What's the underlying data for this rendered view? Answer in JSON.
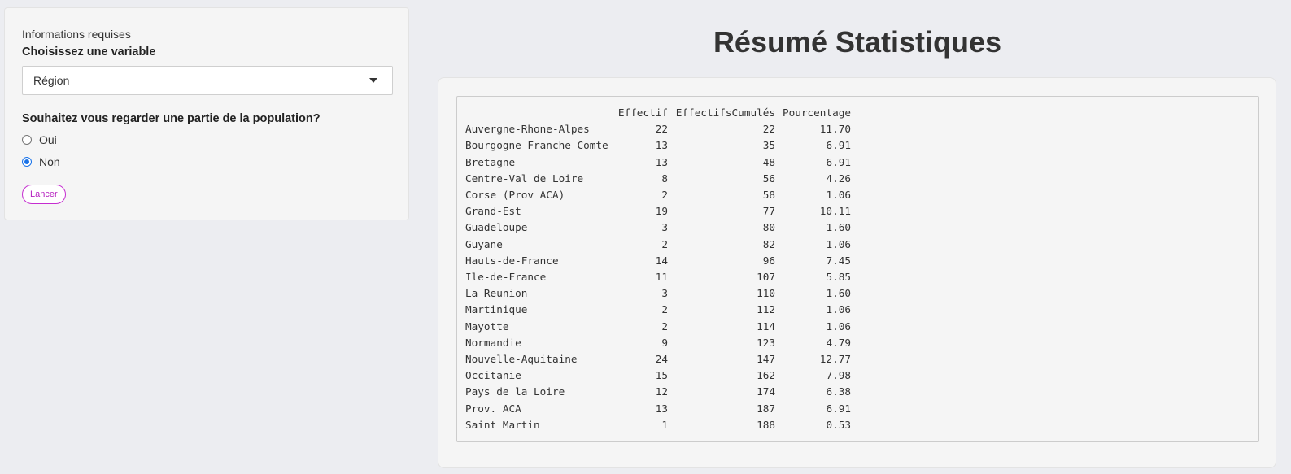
{
  "sidebar": {
    "section_label": "Informations requises",
    "variable_label": "Choisissez une variable",
    "variable_selected": "Région",
    "population_question": "Souhaitez vous regarder une partie de la population?",
    "radio_options": [
      {
        "label": "Oui",
        "checked": false
      },
      {
        "label": "Non",
        "checked": true
      }
    ],
    "run_button_label": "Lancer"
  },
  "main": {
    "title": "Résumé Statistiques",
    "table": {
      "columns": [
        "",
        "Effectif",
        "EffectifsCumulés",
        "Pourcentage"
      ],
      "rows": [
        [
          "Auvergne-Rhone-Alpes",
          "22",
          "22",
          "11.70"
        ],
        [
          "Bourgogne-Franche-Comte",
          "13",
          "35",
          "6.91"
        ],
        [
          "Bretagne",
          "13",
          "48",
          "6.91"
        ],
        [
          "Centre-Val de Loire",
          "8",
          "56",
          "4.26"
        ],
        [
          "Corse (Prov ACA)",
          "2",
          "58",
          "1.06"
        ],
        [
          "Grand-Est",
          "19",
          "77",
          "10.11"
        ],
        [
          "Guadeloupe",
          "3",
          "80",
          "1.60"
        ],
        [
          "Guyane",
          "2",
          "82",
          "1.06"
        ],
        [
          "Hauts-de-France",
          "14",
          "96",
          "7.45"
        ],
        [
          "Ile-de-France",
          "11",
          "107",
          "5.85"
        ],
        [
          "La Reunion",
          "3",
          "110",
          "1.60"
        ],
        [
          "Martinique",
          "2",
          "112",
          "1.06"
        ],
        [
          "Mayotte",
          "2",
          "114",
          "1.06"
        ],
        [
          "Normandie",
          "9",
          "123",
          "4.79"
        ],
        [
          "Nouvelle-Aquitaine",
          "24",
          "147",
          "12.77"
        ],
        [
          "Occitanie",
          "15",
          "162",
          "7.98"
        ],
        [
          "Pays de la Loire",
          "12",
          "174",
          "6.38"
        ],
        [
          "Prov. ACA",
          "13",
          "187",
          "6.91"
        ],
        [
          "Saint Martin",
          "1",
          "188",
          "0.53"
        ]
      ]
    }
  },
  "colors": {
    "background": "#ecedf1",
    "panel": "#f5f5f5",
    "button_accent": "#c52dd0",
    "radio_accent": "#1a73e8"
  }
}
